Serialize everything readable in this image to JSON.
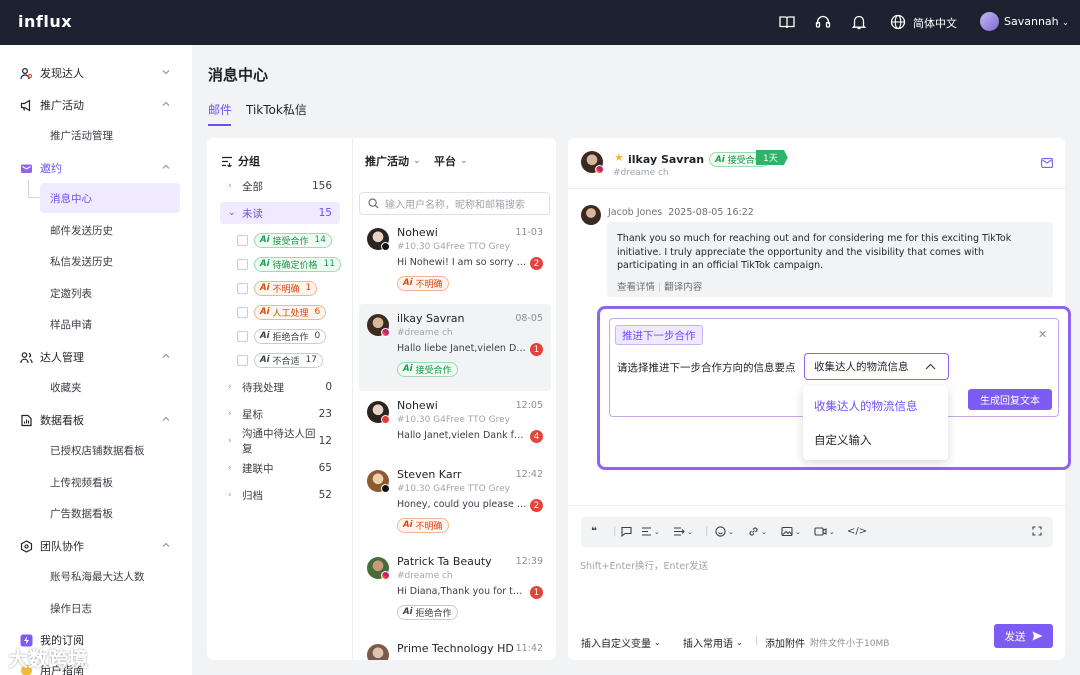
{
  "app": {
    "logo": "influx",
    "language": "简体中文",
    "user": "Savannah"
  },
  "sidebar": {
    "groups": [
      {
        "label": "发现达人"
      },
      {
        "label": "推广活动"
      },
      {
        "label": "邀约"
      },
      {
        "label": "达人管理"
      },
      {
        "label": "数据看板"
      },
      {
        "label": "团队协作"
      },
      {
        "label": "我的订阅"
      },
      {
        "label": "用户指南"
      }
    ],
    "items": {
      "campaign_mgmt": "推广活动管理",
      "message_center": "消息中心",
      "email_history": "邮件发送历史",
      "dm_history": "私信发送历史",
      "invite_list": "定邀列表",
      "sample_request": "样品申请",
      "favorites": "收藏夹",
      "shop_board": "已授权店铺数据看板",
      "video_board": "上传视频看板",
      "ad_board": "广告数据看板",
      "top_creators": "账号私海最大达人数",
      "op_log": "操作日志"
    }
  },
  "page": {
    "title": "消息中心",
    "tabs": [
      "邮件",
      "TikTok私信"
    ]
  },
  "groups_panel": {
    "title": "分组",
    "rows": [
      {
        "label": "全部",
        "count": "156"
      },
      {
        "label": "未读",
        "count": "15"
      }
    ],
    "ai_tags": [
      {
        "label": "接受合作",
        "count": "14",
        "color": "green"
      },
      {
        "label": "待确定价格",
        "count": "11",
        "color": "green"
      },
      {
        "label": "不明确",
        "count": "1",
        "color": "orange"
      },
      {
        "label": "人工处理",
        "count": "6",
        "color": "orange"
      },
      {
        "label": "拒绝合作",
        "count": "0",
        "color": "gray"
      },
      {
        "label": "不合适",
        "count": "17",
        "color": "gray"
      }
    ],
    "rows2": [
      {
        "label": "待我处理",
        "count": "0"
      },
      {
        "label": "星标",
        "count": "23"
      },
      {
        "label": "沟通中待达人回复",
        "count": "12"
      },
      {
        "label": "建联中",
        "count": "65"
      },
      {
        "label": "归档",
        "count": "52"
      }
    ]
  },
  "conversations": {
    "filter_campaign": "推广活动",
    "filter_platform": "平台",
    "search_placeholder": "输入用户名称，昵称和邮箱搜索",
    "ai_prefix": "Ai",
    "items": [
      {
        "name": "Nohewi",
        "time": "11-03",
        "sub": "#10.30 G4Free TTO Grey",
        "msg": "Hi Nohewi! I am so sorry to...",
        "unread": "2",
        "tag": "不明确",
        "tag_color": "orange"
      },
      {
        "name": "ilkay Savran",
        "time": "08-05",
        "sub": "#dreame ch",
        "msg": "Hallo liebe Janet,vielen Da...",
        "unread": "1",
        "tag": "接受合作",
        "tag_color": "green"
      },
      {
        "name": "Nohewi",
        "time": "12:05",
        "sub": "#10.30 G4Free TTO Grey",
        "msg": "Hallo Janet,vielen Dank für...",
        "unread": "4",
        "tag": "",
        "tag_color": ""
      },
      {
        "name": "Steven Karr",
        "time": "12:42",
        "sub": "#10.30 G4Free TTO Grey",
        "msg": "Honey, could you please te...",
        "unread": "2",
        "tag": "不明确",
        "tag_color": "orange"
      },
      {
        "name": "Patrick Ta Beauty",
        "time": "12:39",
        "sub": "#dreame ch",
        "msg": "Hi Diana,Thank you for the...",
        "unread": "1",
        "tag": "拒绝合作",
        "tag_color": "gray"
      },
      {
        "name": "Prime Technology HD",
        "time": "11:42",
        "sub": "",
        "msg": "",
        "unread": "",
        "tag": "",
        "tag_color": ""
      }
    ]
  },
  "chat": {
    "name": "ilkay Savran",
    "status_tag": "接受合作",
    "day_tag": "1天",
    "sub": "#dreame ch",
    "message": {
      "sender": "Jacob Jones",
      "time": "2025-08-05 16:22",
      "text": "Thank you so much for reaching out and for considering me for this exciting TikTok initiative. I truly appreciate the opportunity and the visibility that comes with participating in an official TikTok campaign.",
      "view_details": "查看详情",
      "translate": "翻译内容"
    },
    "suggest": {
      "pill": "推进下一步合作",
      "prompt": "请选择推进下一步合作方向的信息要点",
      "selected": "收集达人的物流信息",
      "options": [
        "收集达人的物流信息",
        "自定义输入"
      ],
      "generate": "生成回复文本"
    },
    "editor": {
      "placeholder": "Shift+Enter换行，Enter发送",
      "insert_var": "插入自定义变量",
      "insert_phrase": "插入常用语",
      "attach": "添加附件",
      "attach_hint": "附件文件小于10MB",
      "send": "发送"
    }
  },
  "watermark": "大数跨境",
  "colors": {
    "accent": "#6e4ff6",
    "topbar": "#1c2230",
    "green": "#2fb36a",
    "unread": "#e5443a"
  }
}
